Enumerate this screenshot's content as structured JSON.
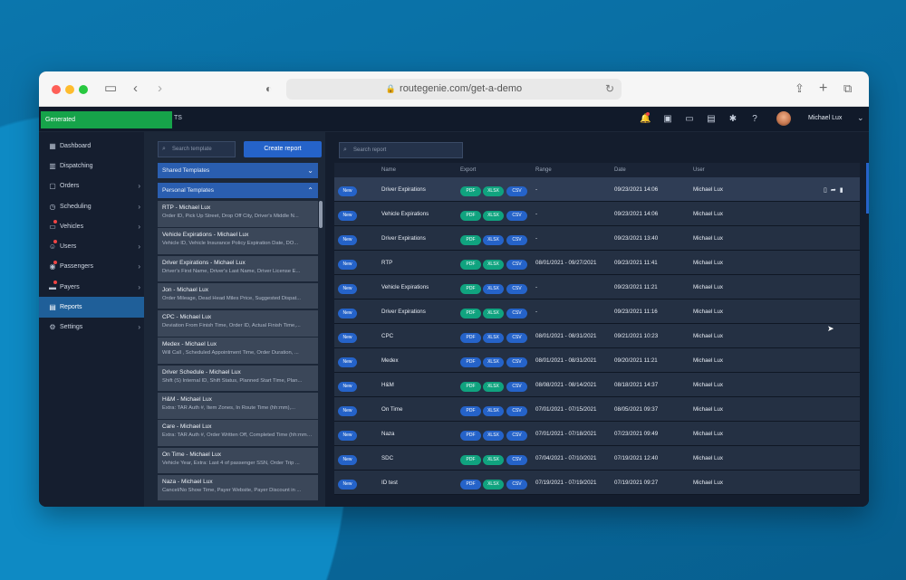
{
  "browser": {
    "url": "routegenie.com/get-a-demo"
  },
  "topbar": {
    "generated_label": "Generated",
    "title_fragment": "TS",
    "username": "Michael Lux"
  },
  "sidebar": {
    "items": [
      {
        "label": "Dashboard",
        "icon": "dashboard-icon"
      },
      {
        "label": "Dispatching",
        "icon": "calendar-icon"
      },
      {
        "label": "Orders",
        "icon": "cart-icon"
      },
      {
        "label": "Scheduling",
        "icon": "clock-icon"
      },
      {
        "label": "Vehicles",
        "icon": "car-icon"
      },
      {
        "label": "Users",
        "icon": "users-icon"
      },
      {
        "label": "Passengers",
        "icon": "pin-icon"
      },
      {
        "label": "Payers",
        "icon": "wallet-icon"
      },
      {
        "label": "Reports",
        "icon": "report-icon"
      },
      {
        "label": "Settings",
        "icon": "gear-icon"
      }
    ]
  },
  "templates": {
    "search_placeholder": "Search template",
    "create_label": "Create report",
    "shared_label": "Shared Templates",
    "personal_label": "Personal Templates",
    "items": [
      {
        "name": "RTP - Michael Lux",
        "desc": "Order ID, Pick Up Street, Drop Off City, Driver's Middle N..."
      },
      {
        "name": "Vehicle Expirations - Michael Lux",
        "desc": "Vehicle ID, Vehicle Insurance Policy Expiration Date, DO..."
      },
      {
        "name": "Driver Expirations - Michael Lux",
        "desc": "Driver's First Name, Driver's Last Name, Driver License E..."
      },
      {
        "name": "Jon - Michael Lux",
        "desc": "Order Mileage, Dead Head Miles Price, Suggested Dispat..."
      },
      {
        "name": "CPC - Michael Lux",
        "desc": "Deviation From Finish Time, Order ID, Actual Finish Time,..."
      },
      {
        "name": "Medex - Michael Lux",
        "desc": "Will Call , Scheduled Appointment Time, Order Duration, ..."
      },
      {
        "name": "Driver Schedule - Michael Lux",
        "desc": "Shift (S) Internal ID, Shift Status, Planned Start Time, Plan..."
      },
      {
        "name": "H&M - Michael Lux",
        "desc": "Extra: TAR Auth #, Item Zones, In Route Time (hh:mm),..."
      },
      {
        "name": "Care - Michael Lux",
        "desc": "Extra: TAR Auth #, Order Written Off, Completed Time (hh:mm),..."
      },
      {
        "name": "On Time - Michael Lux",
        "desc": "Vehicle Year, Extra: Last 4 of passenger SSN, Order Trip ..."
      },
      {
        "name": "Naza - Michael Lux",
        "desc": "Cancel/No Show Time, Payer Website, Payer Discount in ..."
      }
    ]
  },
  "reports": {
    "search_placeholder": "Search report",
    "columns": {
      "name": "Name",
      "export": "Export",
      "range": "Range",
      "date": "Date",
      "user": "User"
    },
    "rows": [
      {
        "badge": "New",
        "name": "Driver Expirations",
        "exports": [
          "PDF",
          "XLSX",
          "CSV"
        ],
        "colors": [
          "green",
          "green",
          "blue"
        ],
        "range": "-",
        "date": "09/23/2021 14:06",
        "user": "Michael Lux"
      },
      {
        "badge": "New",
        "name": "Vehicle Expirations",
        "exports": [
          "PDF",
          "XLSX",
          "CSV"
        ],
        "colors": [
          "green",
          "green",
          "blue"
        ],
        "range": "-",
        "date": "09/23/2021 14:06",
        "user": "Michael Lux"
      },
      {
        "badge": "New",
        "name": "Driver Expirations",
        "exports": [
          "PDF",
          "XLSX",
          "CSV"
        ],
        "colors": [
          "green",
          "blue",
          "blue"
        ],
        "range": "-",
        "date": "09/23/2021 13:40",
        "user": "Michael Lux"
      },
      {
        "badge": "New",
        "name": "RTP",
        "exports": [
          "PDF",
          "XLSX",
          "CSV"
        ],
        "colors": [
          "green",
          "green",
          "blue"
        ],
        "range": "08/01/2021 - 09/27/2021",
        "date": "09/23/2021 11:41",
        "user": "Michael Lux"
      },
      {
        "badge": "New",
        "name": "Vehicle Expirations",
        "exports": [
          "PDF",
          "XLSX",
          "CSV"
        ],
        "colors": [
          "green",
          "blue",
          "blue"
        ],
        "range": "-",
        "date": "09/23/2021 11:21",
        "user": "Michael Lux"
      },
      {
        "badge": "New",
        "name": "Driver Expirations",
        "exports": [
          "PDF",
          "XLSX",
          "CSV"
        ],
        "colors": [
          "green",
          "green",
          "blue"
        ],
        "range": "-",
        "date": "09/23/2021 11:16",
        "user": "Michael Lux"
      },
      {
        "badge": "New",
        "name": "CPC",
        "exports": [
          "PDF",
          "XLSX",
          "CSV"
        ],
        "colors": [
          "blue",
          "blue",
          "blue"
        ],
        "range": "08/01/2021 - 08/31/2021",
        "date": "09/21/2021 10:23",
        "user": "Michael Lux"
      },
      {
        "badge": "New",
        "name": "Medex",
        "exports": [
          "PDF",
          "XLSX",
          "CSV"
        ],
        "colors": [
          "blue",
          "blue",
          "blue"
        ],
        "range": "08/01/2021 - 08/31/2021",
        "date": "09/20/2021 11:21",
        "user": "Michael Lux"
      },
      {
        "badge": "New",
        "name": "H&M",
        "exports": [
          "PDF",
          "XLSX",
          "CSV"
        ],
        "colors": [
          "green",
          "green",
          "blue"
        ],
        "range": "08/08/2021 - 08/14/2021",
        "date": "08/18/2021 14:37",
        "user": "Michael Lux"
      },
      {
        "badge": "New",
        "name": "On Time",
        "exports": [
          "PDF",
          "XLSX",
          "CSV"
        ],
        "colors": [
          "blue",
          "blue",
          "blue"
        ],
        "range": "07/01/2021 - 07/15/2021",
        "date": "08/05/2021 09:37",
        "user": "Michael Lux"
      },
      {
        "badge": "New",
        "name": "Naza",
        "exports": [
          "PDF",
          "XLSX",
          "CSV"
        ],
        "colors": [
          "blue",
          "blue",
          "blue"
        ],
        "range": "07/01/2021 - 07/18/2021",
        "date": "07/23/2021 09:49",
        "user": "Michael Lux"
      },
      {
        "badge": "New",
        "name": "SDC",
        "exports": [
          "PDF",
          "XLSX",
          "CSV"
        ],
        "colors": [
          "green",
          "green",
          "blue"
        ],
        "range": "07/04/2021 - 07/10/2021",
        "date": "07/19/2021 12:40",
        "user": "Michael Lux"
      },
      {
        "badge": "New",
        "name": "ID test",
        "exports": [
          "PDF",
          "XLSX",
          "CSV"
        ],
        "colors": [
          "blue",
          "green",
          "blue"
        ],
        "range": "07/19/2021 - 07/19/2021",
        "date": "07/19/2021 09:27",
        "user": "Michael Lux"
      }
    ]
  }
}
